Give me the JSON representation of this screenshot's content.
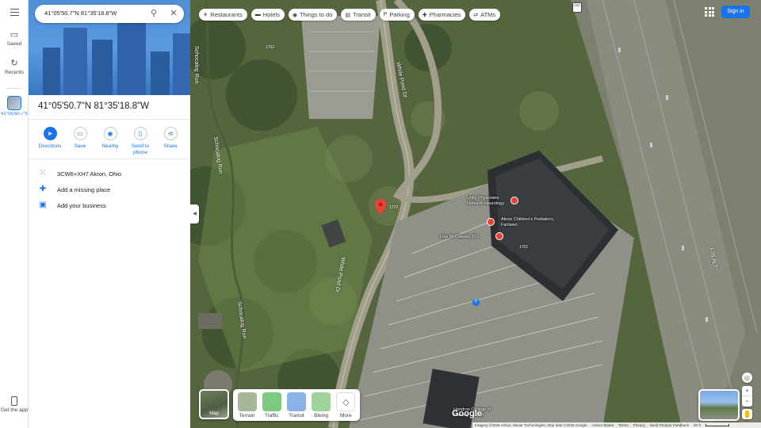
{
  "search": {
    "query": "41°05'50.7\"N 81°35'18.8\"W"
  },
  "rail": {
    "saved_label": "Saved",
    "recents_label": "Recents",
    "recent_item_label": "41°05'50.7\"N...",
    "get_app_label": "Get the app"
  },
  "panel": {
    "title": "41°05'50.7\"N 81°35'18.8\"W",
    "actions": [
      {
        "label": "Directions",
        "icon": "directions-icon"
      },
      {
        "label": "Save",
        "icon": "bookmark-icon"
      },
      {
        "label": "Nearby",
        "icon": "nearby-icon"
      },
      {
        "label": "Send to phone",
        "icon": "phone-icon"
      },
      {
        "label": "Share",
        "icon": "share-icon"
      }
    ],
    "rows": [
      {
        "text": "3CW6+XH7 Akron, Ohio",
        "icon": "plus-code-icon"
      },
      {
        "text": "Add a missing place",
        "icon": "add-place-icon"
      },
      {
        "text": "Add your business",
        "icon": "business-icon"
      }
    ]
  },
  "chips": [
    {
      "label": "Restaurants",
      "icon": "restaurant-icon"
    },
    {
      "label": "Hotels",
      "icon": "hotel-icon"
    },
    {
      "label": "Things to do",
      "icon": "camera-icon"
    },
    {
      "label": "Transit",
      "icon": "transit-icon"
    },
    {
      "label": "Parking",
      "icon": "parking-icon"
    },
    {
      "label": "Pharmacies",
      "icon": "pharmacy-icon"
    },
    {
      "label": "ATMs",
      "icon": "atm-icon"
    }
  ],
  "signin_label": "Sign in",
  "map": {
    "roads": [
      "White Pond Dr",
      "Schocalog Run",
      "Schocalog Run",
      "White Pond Dr",
      "Schocalog Run"
    ],
    "highway_label": "I-76 ALT",
    "highway_shield": "224",
    "pois": [
      "Unity Physicians Network-Neurology",
      "Akron Children's Pediatrics, Fairlawn",
      "Lisa M. Oswald, DO"
    ],
    "numbers": [
      "1772",
      "1702",
      "1701"
    ],
    "parking_badge": "P",
    "bottom_poi": "Hondros College of Nursing - Akron"
  },
  "layers": {
    "main_label": "Map",
    "items": [
      {
        "label": "Terrain",
        "color": "#a7b59a"
      },
      {
        "label": "Traffic",
        "color": "#7cc97f"
      },
      {
        "label": "Transit",
        "color": "#8bb1e8"
      },
      {
        "label": "Biking",
        "color": "#9ed49a"
      },
      {
        "label": "More",
        "color": "#ffffff"
      }
    ]
  },
  "footer": {
    "imagery": "Imagery ©2025 Airbus, Maxar Technologies, Map data ©2025 Google",
    "country": "United States",
    "terms": "Terms",
    "privacy": "Privacy",
    "feedback": "Send Product Feedback",
    "scale": "50 ft"
  },
  "logo": "Google",
  "colors": {
    "accent": "#1a73e8",
    "pin": "#ea4335"
  }
}
